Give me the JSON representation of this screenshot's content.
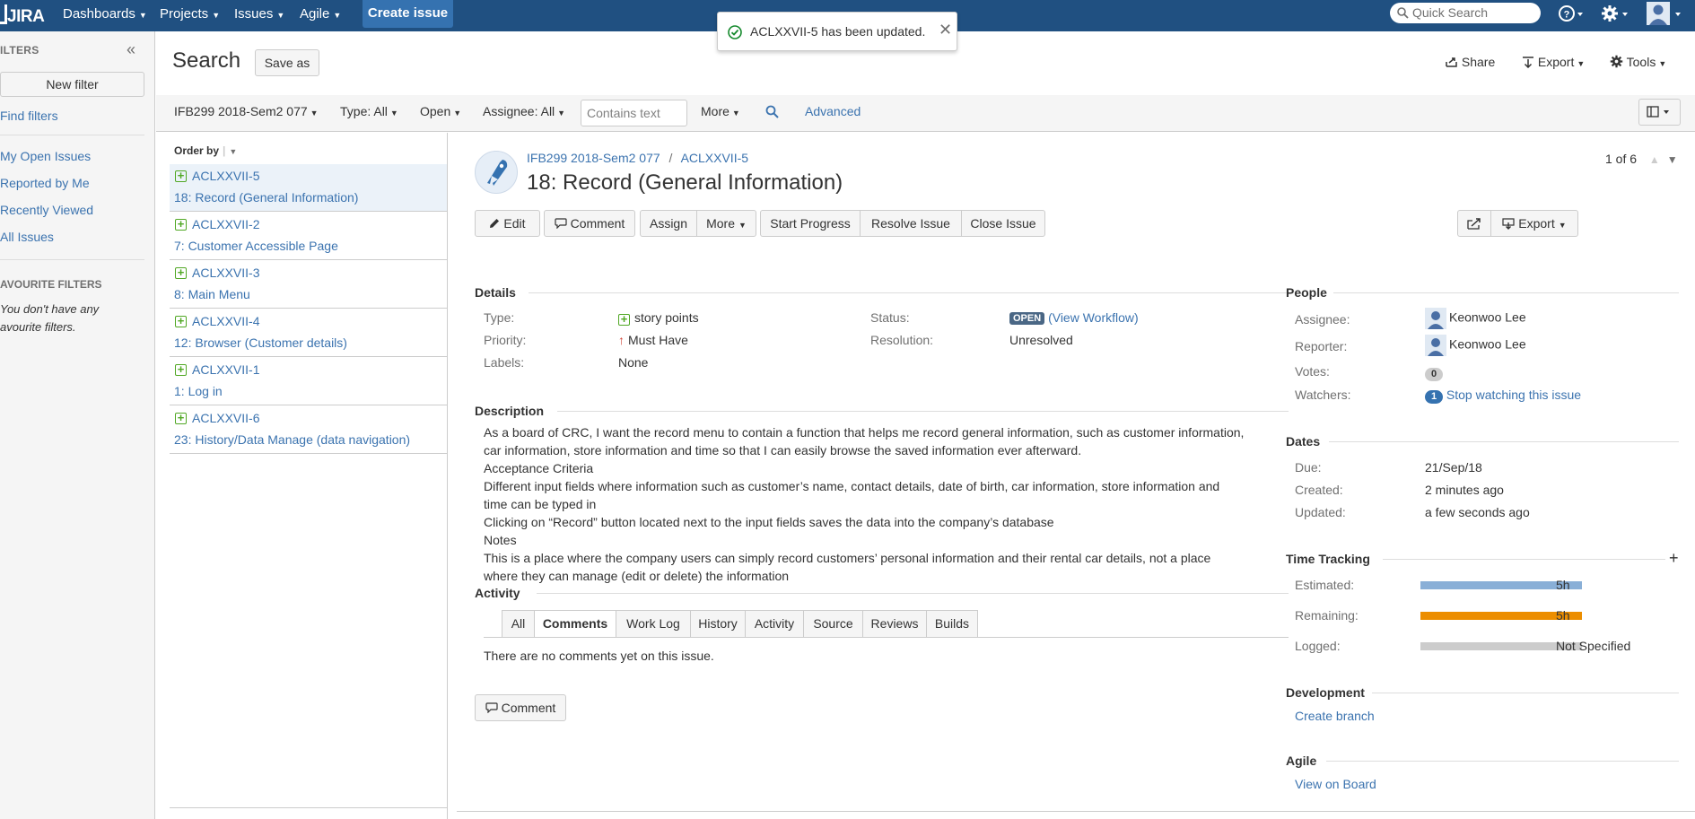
{
  "topbar": {
    "logo": "JIRA",
    "nav": [
      "Dashboards",
      "Projects",
      "Issues",
      "Agile"
    ],
    "create_label": "Create issue",
    "search_placeholder": "Quick Search"
  },
  "toast": {
    "message": "ACLXXVII-5 has been updated."
  },
  "sidebar": {
    "heading": "ILTERS",
    "new_filter": "New filter",
    "find_filters": "Find filters",
    "links": [
      "My Open Issues",
      "Reported by Me",
      "Recently Viewed",
      "All Issues"
    ],
    "favourites_heading": "AVOURITE FILTERS",
    "favourites_empty": "You don't have any avourite filters."
  },
  "header": {
    "title": "Search",
    "save_as": "Save as",
    "share": "Share",
    "export": "Export",
    "tools": "Tools"
  },
  "filterbar": {
    "project": "IFB299 2018-Sem2 077",
    "type": "Type: All",
    "status": "Open",
    "assignee": "Assignee: All",
    "contains_placeholder": "Contains text",
    "more": "More",
    "advanced": "Advanced"
  },
  "list": {
    "order_by": "Order by",
    "items": [
      {
        "key": "ACLXXVII-5",
        "summary": "18: Record (General Information)"
      },
      {
        "key": "ACLXXVII-2",
        "summary": "7: Customer Accessible Page"
      },
      {
        "key": "ACLXXVII-3",
        "summary": "8: Main Menu"
      },
      {
        "key": "ACLXXVII-4",
        "summary": "12: Browser (Customer details)"
      },
      {
        "key": "ACLXXVII-1",
        "summary": "1: Log in"
      },
      {
        "key": "ACLXXVII-6",
        "summary": "23: History/Data Manage (data navigation)"
      }
    ]
  },
  "issue": {
    "project": "IFB299 2018-Sem2 077",
    "separator": "/",
    "key": "ACLXXVII-5",
    "title": "18: Record (General Information)",
    "pager": "1 of 6",
    "ops": {
      "edit": "Edit",
      "comment": "Comment",
      "assign": "Assign",
      "more": "More",
      "start_progress": "Start Progress",
      "resolve": "Resolve Issue",
      "close": "Close Issue",
      "export": "Export"
    },
    "details": {
      "heading": "Details",
      "type_label": "Type:",
      "type": "story points",
      "priority_label": "Priority:",
      "priority": "Must Have",
      "labels_label": "Labels:",
      "labels": "None",
      "status_label": "Status:",
      "status": "OPEN",
      "view_workflow": "(View Workflow)",
      "resolution_label": "Resolution:",
      "resolution": "Unresolved"
    },
    "description": {
      "heading": "Description",
      "lines": [
        "As a board of CRC, I want the record menu to contain a function that helps me record general information, such as customer information, car information, store information and time so that I can easily browse the saved information ever afterward.",
        "Acceptance Criteria",
        "Different input fields where information such as customer’s name, contact details, date of birth, car information, store information and time can be typed in",
        "Clicking on “Record” button located next to the input fields saves the data into the company’s database",
        "Notes",
        "This is a place where the company users can simply record customers’ personal information and their rental car details, not a place where they can manage (edit or delete) the information"
      ]
    },
    "activity": {
      "heading": "Activity",
      "tabs": [
        "All",
        "Comments",
        "Work Log",
        "History",
        "Activity",
        "Source",
        "Reviews",
        "Builds"
      ],
      "active_tab": "Comments",
      "empty": "There are no comments yet on this issue.",
      "comment_button": "Comment"
    },
    "people": {
      "heading": "People",
      "assignee_label": "Assignee:",
      "assignee": "Keonwoo Lee",
      "reporter_label": "Reporter:",
      "reporter": "Keonwoo Lee",
      "votes_label": "Votes:",
      "votes": "0",
      "watchers_label": "Watchers:",
      "watchers": "1",
      "stop_watching": "Stop watching this issue"
    },
    "dates": {
      "heading": "Dates",
      "due_label": "Due:",
      "due": "21/Sep/18",
      "created_label": "Created:",
      "created": "2 minutes ago",
      "updated_label": "Updated:",
      "updated": "a few seconds ago"
    },
    "time_tracking": {
      "heading": "Time Tracking",
      "estimated_label": "Estimated:",
      "estimated": "5h",
      "remaining_label": "Remaining:",
      "remaining": "5h",
      "logged_label": "Logged:",
      "logged": "Not Specified",
      "colors": {
        "estimated": "#89afd7",
        "remaining": "#ec8e00",
        "logged": "#cccccc"
      }
    },
    "development": {
      "heading": "Development",
      "create_branch": "Create branch"
    },
    "agile": {
      "heading": "Agile",
      "view_on_board": "View on Board"
    }
  },
  "colors": {
    "topbar": "#205081",
    "link": "#3b73af",
    "create": "#3572b0"
  }
}
